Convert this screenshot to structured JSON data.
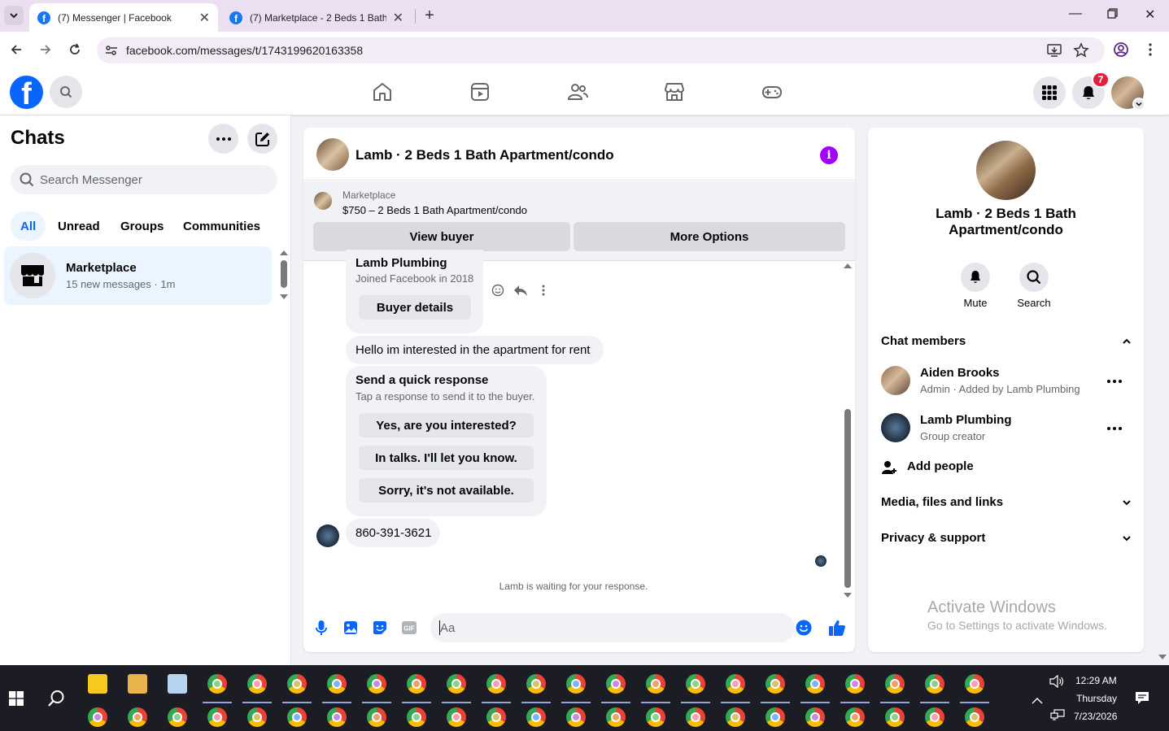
{
  "browser": {
    "tabs": [
      {
        "title": "(7) Messenger | Facebook",
        "active": true
      },
      {
        "title": "(7) Marketplace - 2 Beds 1 Bath",
        "active": false
      }
    ],
    "url": "facebook.com/messages/t/1743199620163358"
  },
  "fb": {
    "notification_count": "7"
  },
  "chats": {
    "title": "Chats",
    "search_placeholder": "Search Messenger",
    "filters": [
      "All",
      "Unread",
      "Groups",
      "Communities"
    ],
    "items": [
      {
        "name": "Marketplace",
        "preview": "15 new messages · 1m"
      }
    ]
  },
  "conversation": {
    "title": "Lamb · 2 Beds 1 Bath Apartment/condo",
    "marketplace_label": "Marketplace",
    "listing": "$750 – 2 Beds 1 Bath Apartment/condo",
    "view_buyer": "View buyer",
    "more_options": "More Options",
    "buyer_card": {
      "name": "Lamb Plumbing",
      "joined": "Joined Facebook in 2018",
      "details_button": "Buyer details"
    },
    "message1": "Hello im interested in the apartment for rent",
    "quick_response": {
      "title": "Send a quick response",
      "subtitle": "Tap a response to send it to the buyer.",
      "options": [
        "Yes, are you interested?",
        "In talks. I'll let you know.",
        "Sorry, it's not available."
      ]
    },
    "message2": "860-391-3621",
    "waiting": "Lamb is waiting for your response.",
    "composer_placeholder": "Aa"
  },
  "info_panel": {
    "name_line1": "Lamb · 2 Beds 1 Bath",
    "name_line2": "Apartment/condo",
    "actions": [
      "Mute",
      "Search"
    ],
    "chat_members_label": "Chat members",
    "members": [
      {
        "name": "Aiden Brooks",
        "role": "Admin · Added by Lamb Plumbing"
      },
      {
        "name": "Lamb Plumbing",
        "role": "Group creator"
      }
    ],
    "add_people": "Add people",
    "media_label": "Media, files and links",
    "privacy_label": "Privacy & support",
    "activate_title": "Activate Windows",
    "activate_sub": "Go to Settings to activate Windows."
  },
  "taskbar": {
    "time": "12:29 AM",
    "day": "Thursday",
    "date": "7/23/2026"
  },
  "colors": {
    "fb_blue": "#0866ff",
    "selected_chat": "#ebf5ff",
    "badge_red": "#e41e3f",
    "info_purple": "#a200ff"
  }
}
